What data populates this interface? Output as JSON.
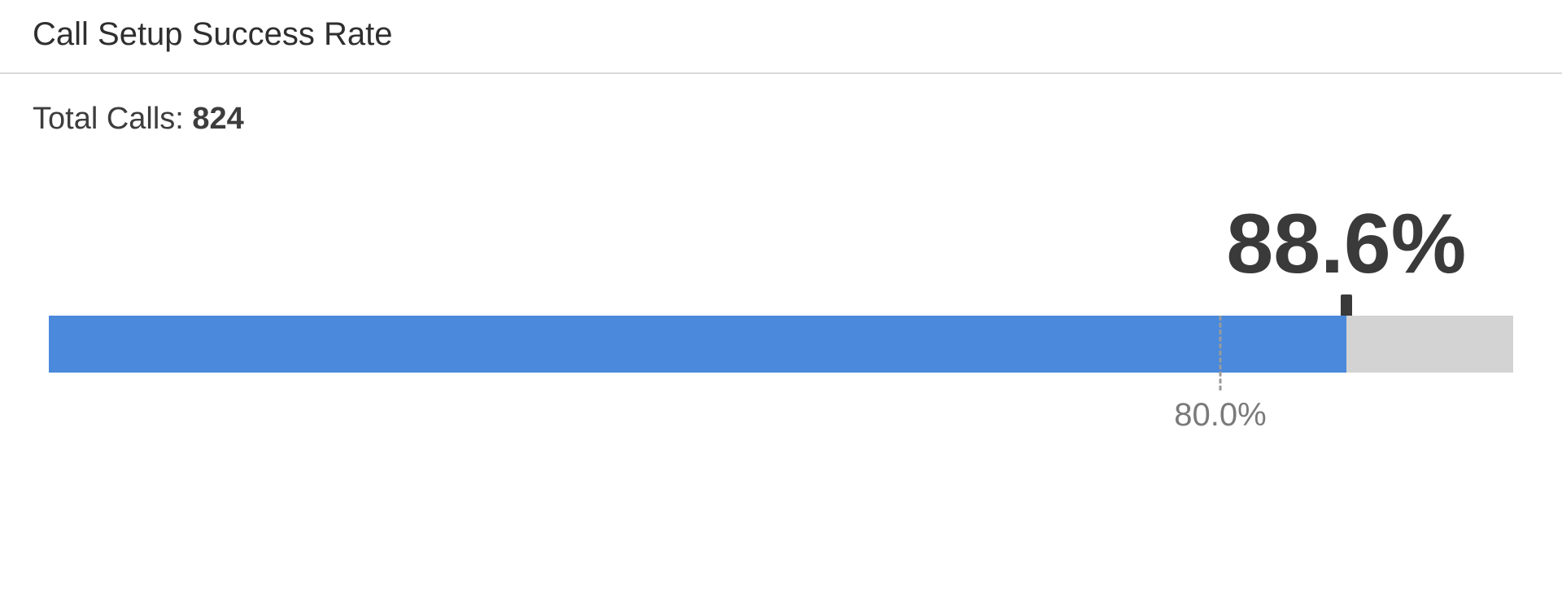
{
  "title": "Call Setup Success Rate",
  "subtitle": {
    "label": "Total Calls: ",
    "value": "824"
  },
  "chart_data": {
    "type": "bullet",
    "value": 88.6,
    "value_label": "88.6%",
    "target": 80.0,
    "target_label": "80.0%",
    "range": [
      0,
      100
    ],
    "bar_color": "#4a89dc",
    "track_color": "#d3d3d3",
    "pointer_color": "#3a3a3a"
  }
}
